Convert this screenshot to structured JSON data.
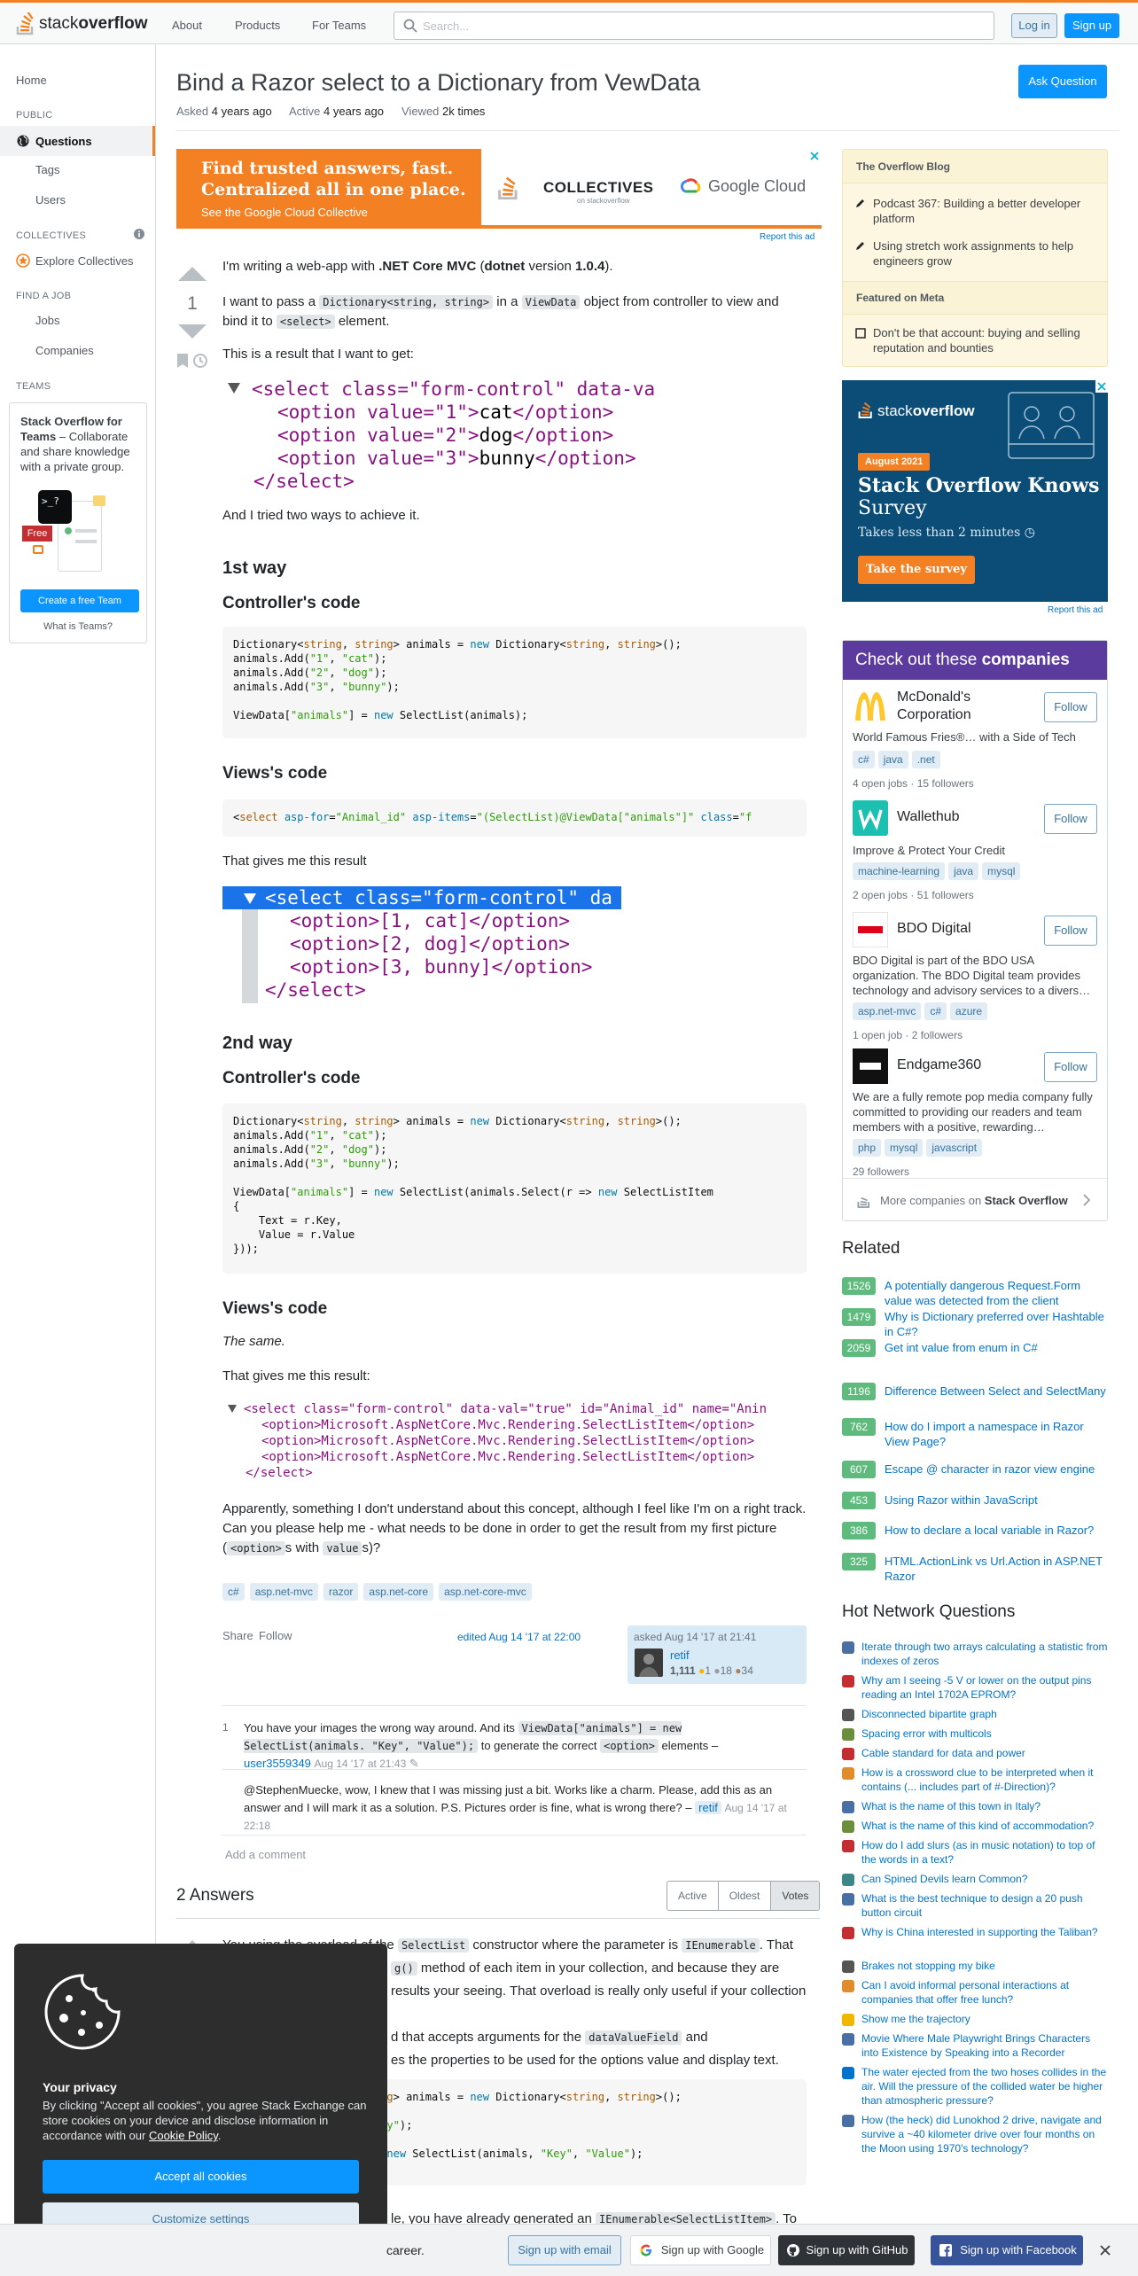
{
  "header": {
    "logo_word1": "stack",
    "logo_word2": "overflow",
    "nav": [
      "About",
      "Products",
      "For Teams"
    ],
    "search_placeholder": "Search...",
    "login": "Log in",
    "signup": "Sign up"
  },
  "sidebar": {
    "home": "Home",
    "public": "PUBLIC",
    "questions": "Questions",
    "tags": "Tags",
    "users": "Users",
    "collectives": "COLLECTIVES",
    "explore_collectives": "Explore Collectives",
    "find_a_job": "FIND A JOB",
    "jobs": "Jobs",
    "companies": "Companies",
    "teams": "TEAMS",
    "teams_title": "Stack Overflow for Teams",
    "teams_text": " – Collaborate and share knowledge with a private group.",
    "teams_badge": "Free",
    "teams_cta": "Create a free Team",
    "teams_link": "What is Teams?"
  },
  "question": {
    "title": "Bind a Razor select to a Dictionary from VewData",
    "ask_button": "Ask Question",
    "asked_label": "Asked",
    "asked_value": "4 years ago",
    "active_label": "Active",
    "active_value": "4 years ago",
    "viewed_label": "Viewed",
    "viewed_value": "2k times",
    "votes": "1",
    "p1_a": "I'm writing a web-app with ",
    "p1_b": ".NET Core MVC",
    "p1_c": " (",
    "p1_d": "dotnet",
    "p1_e": " version ",
    "p1_f": "1.0.4",
    "p1_g": ").",
    "p2_a": "I want to pass a ",
    "p2_code1": "Dictionary<string, string>",
    "p2_b": " in a ",
    "p2_code2": "ViewData",
    "p2_c": " object from controller to view and bind it to ",
    "p2_code3": "<select>",
    "p2_d": " element.",
    "p3": "This is a result that I want to get:",
    "p4": "And I tried two ways to achieve it.",
    "h_way1": "1st way",
    "h_ctrl1": "Controller's code",
    "h_views1": "Views's code",
    "p5": "That gives me this result",
    "h_way2": "2nd way",
    "h_ctrl2": "Controller's code",
    "h_views2": "Views's code",
    "p6": "The same.",
    "p7": "That gives me this result:",
    "p8_a": "Apparently, something I don't understand about this concept, although I feel like I'm on a right track. Can you please help me - what needs to be done in order to get the result from my first picture (",
    "p8_code1": "<option>",
    "p8_b": "s with ",
    "p8_code2": "value",
    "p8_c": "s)?",
    "tags": [
      "c#",
      "asp.net-mvc",
      "razor",
      "asp.net-core",
      "asp.net-core-mvc"
    ],
    "share": "Share",
    "follow": "Follow",
    "edited": "edited Aug 14 '17 at 22:00",
    "asked_card": "asked Aug 14 '17 at 21:41",
    "user": "retif",
    "user_rep": "1,111",
    "user_gold": "1",
    "user_silver": "18",
    "user_bronze": "34"
  },
  "img1": {
    "line1": "<select class=\"form-control\" data-va",
    "line2a": "<option value=\"1\">",
    "line2b": "cat",
    "line2c": "</option>",
    "line3a": "<option value=\"2\">",
    "line3b": "dog",
    "line3c": "</option>",
    "line4a": "<option value=\"3\">",
    "line4b": "bunny",
    "line4c": "</option>",
    "line5": "</select>"
  },
  "img2": {
    "line1": "<select class=\"form-control\" da",
    "line2": "<option>[1, cat]</option>",
    "line3": "<option>[2, dog]</option>",
    "line4": "<option>[3, bunny]</option>",
    "line5": "</select>"
  },
  "img3": {
    "line1": "<select class=\"form-control\" data-val=\"true\" id=\"Animal_id\" name=\"Anin",
    "line2": "<option>Microsoft.AspNetCore.Mvc.Rendering.SelectListItem</option>",
    "line5": "</select>"
  },
  "comments": {
    "c1_votes": "1",
    "c1_a": "You have your images the wrong way around. And its ",
    "c1_code1": "ViewData[\"animals\"] = new SelectList(animals. \"Key\", \"Value\");",
    "c1_b": " to generate the correct ",
    "c1_code2": "<option>",
    "c1_c": " elements –",
    "c1_user": "user3559349",
    "c1_time": "Aug 14 '17 at 21:43",
    "c2_text": "@StephenMuecke, wow, I knew that I was missing just a bit. Works like a charm. Please, add this as an answer and I will mark it as a solution. P.S. Pictures order is fine, what is wrong there? –",
    "c2_user": "retif",
    "c2_time": "Aug 14 '17 at 22:18",
    "add": "Add a comment"
  },
  "answers": {
    "count": "2 Answers",
    "sort": [
      "Active",
      "Oldest",
      "Votes"
    ],
    "a_p1a": "You using the overload of the ",
    "a_code1": "SelectList",
    "a_p1b": " constructor where the parameter is ",
    "a_code2": "IEnumerable",
    "a_p1c": ". That",
    "a_p1d": "g()",
    "a_p1e": " method of each item in your collection, and because they are",
    "a_p1f": "results your seeing. That overload is really only useful if your collection",
    "a_p2a": "d that accepts arguments for the ",
    "a_code3": "dataValueField",
    "a_p2b": " and",
    "a_p2c": "es the properties to be used for the options value and display text.",
    "a_p3a": "le, you have already generated an ",
    "a_code4": "IEnumerable<SelectListItem>",
    "a_p3b": ". To"
  },
  "blog": {
    "title": "The Overflow Blog",
    "items": [
      "Podcast 367: Building a better developer platform",
      "Using stretch work assignments to help engineers grow"
    ],
    "meta_title": "Featured on Meta",
    "meta_items": [
      "Don't be that account: buying and selling reputation and bounties"
    ]
  },
  "ads": {
    "top_line1": "Find trusted answers, fast.",
    "top_line2": "Centralized all in one place.",
    "top_line3": "See the Google Cloud Collective",
    "top_collectives": "COLLECTIVES",
    "top_on": "on stackoverflow",
    "top_google": "Google Cloud",
    "report": "Report this ad",
    "side_badge": "August 2021",
    "side_t1": "Stack Overflow Knows",
    "side_t2": "Survey",
    "side_t3": "Takes less than 2 minutes",
    "side_cta": "Take the survey"
  },
  "companies": {
    "title_a": "Check out these ",
    "title_b": "companies",
    "list": [
      {
        "name": "McDonald's Corporation",
        "desc": "World Famous Fries®… with a Side of Tech",
        "tags": [
          "c#",
          "java",
          ".net"
        ],
        "stats": "4 open jobs · 15 followers"
      },
      {
        "name": "Wallethub",
        "desc": "Improve & Protect Your Credit",
        "tags": [
          "machine-learning",
          "java",
          "mysql"
        ],
        "stats": "2 open jobs · 51 followers"
      },
      {
        "name": "BDO Digital",
        "desc": "BDO Digital is part of the BDO USA organization. The BDO Digital team provides technology and advisory services to a divers…",
        "tags": [
          "asp.net-mvc",
          "c#",
          "azure"
        ],
        "stats": "1 open job · 2 followers"
      },
      {
        "name": "Endgame360",
        "desc": "We are a fully remote pop media company fully committed to providing our readers and team members with a positive, rewarding…",
        "tags": [
          "php",
          "mysql",
          "javascript"
        ],
        "stats": "29 followers"
      }
    ],
    "follow": "Follow",
    "more_a": "More companies on ",
    "more_b": "Stack Overflow"
  },
  "related": {
    "title": "Related",
    "items": [
      {
        "count": "1526",
        "text": "A potentially dangerous Request.Form value was detected from the client"
      },
      {
        "count": "1479",
        "text": "Why is Dictionary preferred over Hashtable in C#?"
      },
      {
        "count": "2059",
        "text": "Get int value from enum in C#"
      },
      {
        "count": "1196",
        "text": "Difference Between Select and SelectMany"
      },
      {
        "count": "762",
        "text": "How do I import a namespace in Razor View Page?"
      },
      {
        "count": "607",
        "text": "Escape @ character in razor view engine"
      },
      {
        "count": "453",
        "text": "Using Razor within JavaScript"
      },
      {
        "count": "386",
        "text": "How to declare a local variable in Razor?"
      },
      {
        "count": "325",
        "text": "HTML.ActionLink vs Url.Action in ASP.NET Razor"
      }
    ]
  },
  "hot": {
    "title": "Hot Network Questions",
    "items": [
      "Iterate through two arrays calculating a statistic from indexes of zeros",
      "Why am I seeing -5 V or lower on the output pins reading an Intel 1702A EPROM?",
      "Disconnected bipartite graph",
      "Spacing error with multicols",
      "Cable standard for data and power",
      "How is a crossword clue to be interpreted when it contains (... includes part of #-Direction)?",
      "What is the name of this town in Italy?",
      "What is the name of this kind of accommodation?",
      "How do I add slurs (as in music notation) to top of the words in a text?",
      "Can Spined Devils learn Common?",
      "What is the best technique to design a 20 push button circuit",
      "Why is China interested in supporting the Taliban?",
      "Brakes not stopping my bike",
      "Can I avoid informal personal interactions at companies that offer free lunch?",
      "Show me the trajectory",
      "Movie Where Male Playwright Brings Characters into Existence by Speaking into a Recorder",
      "The water ejected from the two hoses collides in the air. Will the pressure of the collided water be higher than atmospheric pressure?",
      "How (the heck) did Lunokhod 2 drive, navigate and survive a ~40 kilometer drive over four months on the Moon using 1970's technology?"
    ]
  },
  "cookie": {
    "title": "Your privacy",
    "text": "By clicking \"Accept all cookies\", you agree Stack Exchange can store cookies on your device and disclose information in accordance with our ",
    "link": "Cookie Policy",
    "text_end": ".",
    "accept": "Accept all cookies",
    "customize": "Customize settings"
  },
  "bottom": {
    "text": "career.",
    "email": "Sign up with email",
    "google": "Sign up with Google",
    "github": "Sign up with GitHub",
    "facebook": "Sign up with Facebook"
  },
  "colors": {
    "accent": "#f48024",
    "primary": "#0a95ff",
    "link": "#0074cc",
    "tag_bg": "#e1ecf4",
    "tag_fg": "#39739d",
    "answer_green": "#5eba7d",
    "teams_purple": "#5c3b9e"
  }
}
